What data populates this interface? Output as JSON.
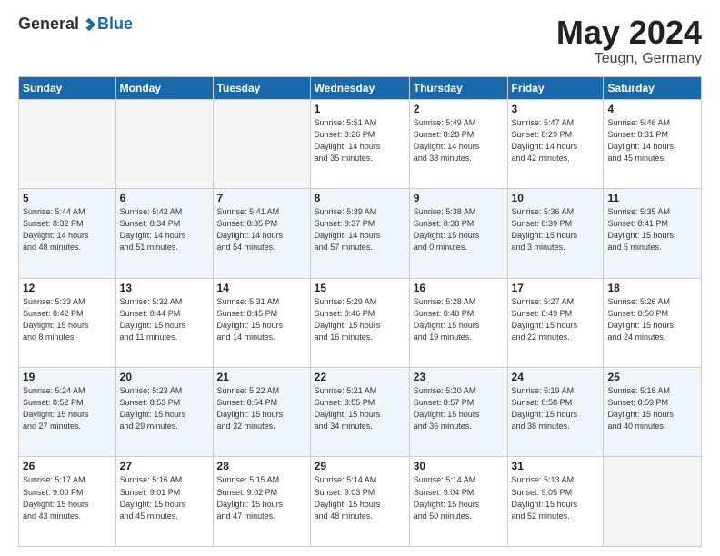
{
  "header": {
    "logo_general": "General",
    "logo_blue": "Blue",
    "title": "May 2024",
    "location": "Teugn, Germany"
  },
  "days_of_week": [
    "Sunday",
    "Monday",
    "Tuesday",
    "Wednesday",
    "Thursday",
    "Friday",
    "Saturday"
  ],
  "weeks": [
    [
      {
        "num": "",
        "info": ""
      },
      {
        "num": "",
        "info": ""
      },
      {
        "num": "",
        "info": ""
      },
      {
        "num": "1",
        "info": "Sunrise: 5:51 AM\nSunset: 8:26 PM\nDaylight: 14 hours\nand 35 minutes."
      },
      {
        "num": "2",
        "info": "Sunrise: 5:49 AM\nSunset: 8:28 PM\nDaylight: 14 hours\nand 38 minutes."
      },
      {
        "num": "3",
        "info": "Sunrise: 5:47 AM\nSunset: 8:29 PM\nDaylight: 14 hours\nand 42 minutes."
      },
      {
        "num": "4",
        "info": "Sunrise: 5:46 AM\nSunset: 8:31 PM\nDaylight: 14 hours\nand 45 minutes."
      }
    ],
    [
      {
        "num": "5",
        "info": "Sunrise: 5:44 AM\nSunset: 8:32 PM\nDaylight: 14 hours\nand 48 minutes."
      },
      {
        "num": "6",
        "info": "Sunrise: 5:42 AM\nSunset: 8:34 PM\nDaylight: 14 hours\nand 51 minutes."
      },
      {
        "num": "7",
        "info": "Sunrise: 5:41 AM\nSunset: 8:35 PM\nDaylight: 14 hours\nand 54 minutes."
      },
      {
        "num": "8",
        "info": "Sunrise: 5:39 AM\nSunset: 8:37 PM\nDaylight: 14 hours\nand 57 minutes."
      },
      {
        "num": "9",
        "info": "Sunrise: 5:38 AM\nSunset: 8:38 PM\nDaylight: 15 hours\nand 0 minutes."
      },
      {
        "num": "10",
        "info": "Sunrise: 5:36 AM\nSunset: 8:39 PM\nDaylight: 15 hours\nand 3 minutes."
      },
      {
        "num": "11",
        "info": "Sunrise: 5:35 AM\nSunset: 8:41 PM\nDaylight: 15 hours\nand 5 minutes."
      }
    ],
    [
      {
        "num": "12",
        "info": "Sunrise: 5:33 AM\nSunset: 8:42 PM\nDaylight: 15 hours\nand 8 minutes."
      },
      {
        "num": "13",
        "info": "Sunrise: 5:32 AM\nSunset: 8:44 PM\nDaylight: 15 hours\nand 11 minutes."
      },
      {
        "num": "14",
        "info": "Sunrise: 5:31 AM\nSunset: 8:45 PM\nDaylight: 15 hours\nand 14 minutes."
      },
      {
        "num": "15",
        "info": "Sunrise: 5:29 AM\nSunset: 8:46 PM\nDaylight: 15 hours\nand 16 minutes."
      },
      {
        "num": "16",
        "info": "Sunrise: 5:28 AM\nSunset: 8:48 PM\nDaylight: 15 hours\nand 19 minutes."
      },
      {
        "num": "17",
        "info": "Sunrise: 5:27 AM\nSunset: 8:49 PM\nDaylight: 15 hours\nand 22 minutes."
      },
      {
        "num": "18",
        "info": "Sunrise: 5:26 AM\nSunset: 8:50 PM\nDaylight: 15 hours\nand 24 minutes."
      }
    ],
    [
      {
        "num": "19",
        "info": "Sunrise: 5:24 AM\nSunset: 8:52 PM\nDaylight: 15 hours\nand 27 minutes."
      },
      {
        "num": "20",
        "info": "Sunrise: 5:23 AM\nSunset: 8:53 PM\nDaylight: 15 hours\nand 29 minutes."
      },
      {
        "num": "21",
        "info": "Sunrise: 5:22 AM\nSunset: 8:54 PM\nDaylight: 15 hours\nand 32 minutes."
      },
      {
        "num": "22",
        "info": "Sunrise: 5:21 AM\nSunset: 8:55 PM\nDaylight: 15 hours\nand 34 minutes."
      },
      {
        "num": "23",
        "info": "Sunrise: 5:20 AM\nSunset: 8:57 PM\nDaylight: 15 hours\nand 36 minutes."
      },
      {
        "num": "24",
        "info": "Sunrise: 5:19 AM\nSunset: 8:58 PM\nDaylight: 15 hours\nand 38 minutes."
      },
      {
        "num": "25",
        "info": "Sunrise: 5:18 AM\nSunset: 8:59 PM\nDaylight: 15 hours\nand 40 minutes."
      }
    ],
    [
      {
        "num": "26",
        "info": "Sunrise: 5:17 AM\nSunset: 9:00 PM\nDaylight: 15 hours\nand 43 minutes."
      },
      {
        "num": "27",
        "info": "Sunrise: 5:16 AM\nSunset: 9:01 PM\nDaylight: 15 hours\nand 45 minutes."
      },
      {
        "num": "28",
        "info": "Sunrise: 5:15 AM\nSunset: 9:02 PM\nDaylight: 15 hours\nand 47 minutes."
      },
      {
        "num": "29",
        "info": "Sunrise: 5:14 AM\nSunset: 9:03 PM\nDaylight: 15 hours\nand 48 minutes."
      },
      {
        "num": "30",
        "info": "Sunrise: 5:14 AM\nSunset: 9:04 PM\nDaylight: 15 hours\nand 50 minutes."
      },
      {
        "num": "31",
        "info": "Sunrise: 5:13 AM\nSunset: 9:05 PM\nDaylight: 15 hours\nand 52 minutes."
      },
      {
        "num": "",
        "info": ""
      }
    ]
  ]
}
